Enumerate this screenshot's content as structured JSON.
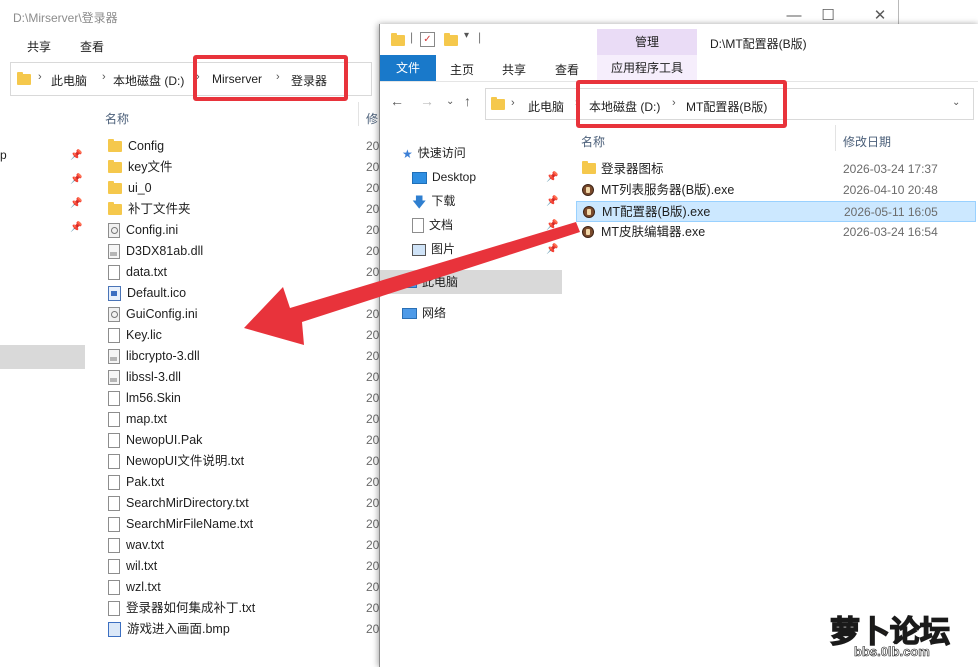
{
  "back_window": {
    "title": "D:\\Mirserver\\登录器",
    "ribbon_tabs": [
      "共享",
      "查看"
    ],
    "breadcrumbs": [
      "此电脑",
      "本地磁盘 (D:)",
      "Mirserver",
      "登录器"
    ],
    "nav_left_fragment": "p",
    "columns": {
      "name": "名称",
      "modified": "修"
    },
    "date_stub": "20",
    "files": [
      {
        "name": "Config",
        "icon": "folder-icon"
      },
      {
        "name": "key文件",
        "icon": "folder-icon"
      },
      {
        "name": "ui_0",
        "icon": "folder-icon"
      },
      {
        "name": "补丁文件夹",
        "icon": "folder-icon"
      },
      {
        "name": "Config.ini",
        "icon": "settings-file-icon"
      },
      {
        "name": "D3DX81ab.dll",
        "icon": "dll-file-icon"
      },
      {
        "name": "data.txt",
        "icon": "text-file-icon"
      },
      {
        "name": "Default.ico",
        "icon": "ico-file-icon"
      },
      {
        "name": "GuiConfig.ini",
        "icon": "settings-file-icon"
      },
      {
        "name": "Key.lic",
        "icon": "text-file-icon"
      },
      {
        "name": "libcrypto-3.dll",
        "icon": "dll-file-icon"
      },
      {
        "name": "libssl-3.dll",
        "icon": "dll-file-icon"
      },
      {
        "name": "lm56.Skin",
        "icon": "text-file-icon"
      },
      {
        "name": "map.txt",
        "icon": "text-file-icon"
      },
      {
        "name": "NewopUI.Pak",
        "icon": "text-file-icon"
      },
      {
        "name": "NewopUI文件说明.txt",
        "icon": "text-file-icon"
      },
      {
        "name": "Pak.txt",
        "icon": "text-file-icon"
      },
      {
        "name": "SearchMirDirectory.txt",
        "icon": "text-file-icon"
      },
      {
        "name": "SearchMirFileName.txt",
        "icon": "text-file-icon"
      },
      {
        "name": "wav.txt",
        "icon": "text-file-icon"
      },
      {
        "name": "wil.txt",
        "icon": "text-file-icon"
      },
      {
        "name": "wzl.txt",
        "icon": "text-file-icon"
      },
      {
        "name": "登录器如何集成补丁.txt",
        "icon": "text-file-icon"
      },
      {
        "name": "游戏进入画面.bmp",
        "icon": "bmp-file-icon"
      }
    ]
  },
  "front_window": {
    "title": "D:\\MT配置器(B版)",
    "manage_tab": "管理",
    "ribbon_tabs": {
      "file": "文件",
      "home": "主页",
      "share": "共享",
      "view": "查看",
      "app_tools": "应用程序工具"
    },
    "breadcrumbs": [
      "此电脑",
      "本地磁盘 (D:)",
      "MT配置器(B版)"
    ],
    "nav": {
      "quick_access": "快速访问",
      "desktop": "Desktop",
      "downloads": "下载",
      "documents": "文档",
      "pictures": "图片",
      "this_pc": "此电脑",
      "network": "网络"
    },
    "columns": {
      "name": "名称",
      "modified": "修改日期"
    },
    "files": [
      {
        "name": "登录器图标",
        "date": "2026-03-24 17:37",
        "icon": "folder-icon",
        "selected": false
      },
      {
        "name": "MT列表服务器(B版).exe",
        "date": "2026-04-10 20:48",
        "icon": "app-exe-icon",
        "selected": false
      },
      {
        "name": "MT配置器(B版).exe",
        "date": "2026-05-11 16:05",
        "icon": "app-exe-icon",
        "selected": true
      },
      {
        "name": "MT皮肤编辑器.exe",
        "date": "2026-03-24 16:54",
        "icon": "app-exe-icon",
        "selected": false
      }
    ]
  },
  "annotation": {
    "highlight_color": "#e8333b",
    "arrow_color": "#e8333b"
  },
  "watermark": {
    "logo_text": "萝卜论坛",
    "url": "bbs.0lb.com"
  },
  "colors": {
    "accent": "#1979ca",
    "manage_tab": "#eadcf6",
    "selection": "#cce8ff",
    "folder": "#f5c84c"
  }
}
